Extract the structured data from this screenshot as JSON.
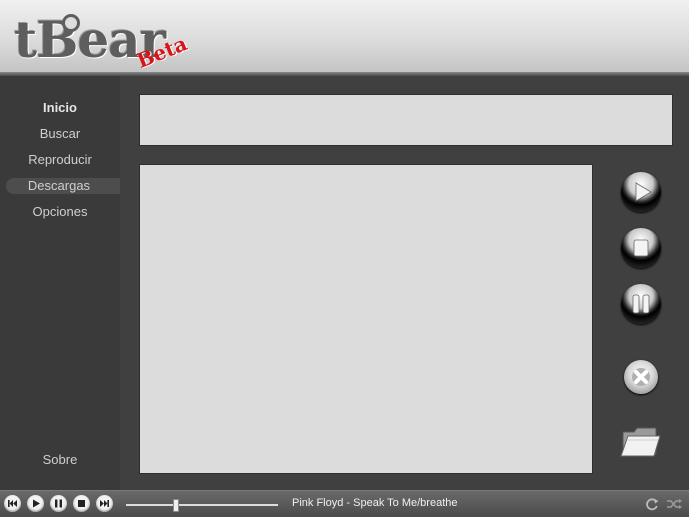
{
  "app": {
    "logo_text": "tBear",
    "logo_badge": "Beta"
  },
  "sidebar": {
    "items": [
      {
        "label": "Inicio",
        "icon": ""
      },
      {
        "label": "Buscar",
        "icon": ""
      },
      {
        "label": "Reproducir",
        "icon": ""
      },
      {
        "label": "Descargas",
        "icon": ""
      },
      {
        "label": "Opciones",
        "icon": ""
      }
    ],
    "selected": "Descargas",
    "footer_label": "Sobre"
  },
  "actions": {
    "play_icon": "play-icon",
    "stop_icon": "stop-icon",
    "pause_icon": "pause-icon",
    "cancel_icon": "cancel-icon",
    "open_folder_icon": "folder-icon"
  },
  "player": {
    "now_playing": "Pink Floyd - Speak To Me/breathe",
    "progress": 0.32,
    "controls": [
      "previous",
      "play",
      "pause",
      "stop",
      "next"
    ],
    "right_icons": [
      "repeat-icon",
      "shuffle-icon"
    ]
  },
  "colors": {
    "accent_badge": "#d8141b",
    "panel": "#dcdcdc",
    "background": "#3d3d3d"
  }
}
